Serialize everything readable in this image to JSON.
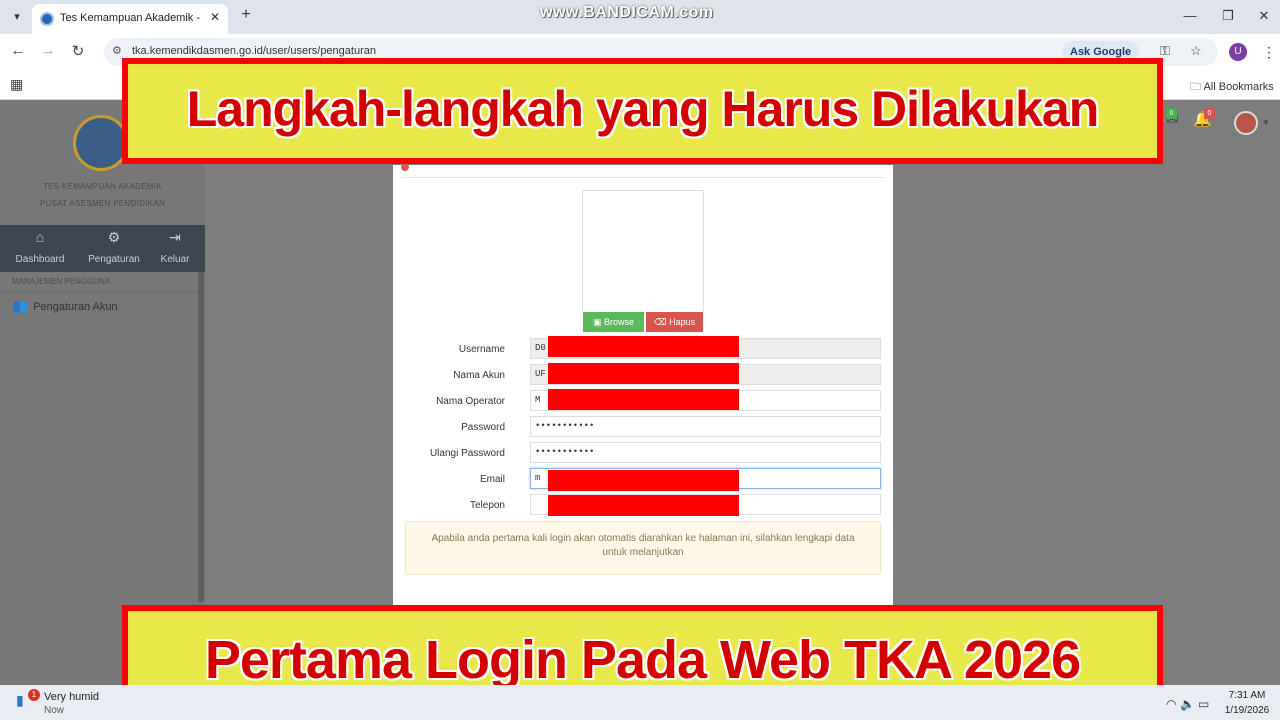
{
  "browser": {
    "tab_title": "Tes Kemampuan Akademik - Ta",
    "watermark": "www.BANDICAM.com",
    "url": "tka.kemendikdasmen.go.id/user/users/pengaturan",
    "ask_google": "Ask Google",
    "profile_initial": "U",
    "all_bookmarks": "All Bookmarks"
  },
  "sidebar": {
    "org_line1": "TES KEMAMPUAN AKADEMIK",
    "org_line2": "PUSAT ASESMEN PENDIDIKAN",
    "nav": [
      {
        "label": "Dashboard",
        "icon": "home-icon"
      },
      {
        "label": "Pengaturan",
        "icon": "user-gear-icon"
      },
      {
        "label": "Keluar",
        "icon": "logout-icon"
      }
    ],
    "section_label": "MANAJEMEN PENGGUNA",
    "account_item": "Pengaturan Akun"
  },
  "header": {
    "badge_green": "0",
    "badge_red": "0"
  },
  "modal": {
    "browse_label": "Browse",
    "hapus_label": "Hapus",
    "fields": [
      {
        "label": "Username",
        "value": "D0"
      },
      {
        "label": "Nama Akun",
        "value": "UF"
      },
      {
        "label": "Nama Operator",
        "value": "M"
      },
      {
        "label": "Password",
        "value": "•••••••••••"
      },
      {
        "label": "Ulangi Password",
        "value": "•••••••••••"
      },
      {
        "label": "Email",
        "value": "m"
      },
      {
        "label": "Telepon",
        "value": ""
      }
    ],
    "notice": "Apabila anda pertama kali login akan otomatis diarahkan ke halaman ini, silahkan lengkapi data untuk melanjutkan"
  },
  "overlay": {
    "top": "Langkah-langkah yang Harus Dilakukan",
    "bottom": "Pertama Login Pada Web TKA 2026"
  },
  "taskbar": {
    "weather_badge": "1",
    "weather": "Very humid",
    "weather_sub": "Now",
    "time": "7:31 AM",
    "date": "1/19/2026"
  },
  "colors": {
    "banner_bg": "#e8e84a",
    "banner_border": "#ff0000",
    "banner_text": "#d40000",
    "redaction": "#ff0000",
    "browse_btn": "#5cb85c",
    "hapus_btn": "#d9534f"
  }
}
